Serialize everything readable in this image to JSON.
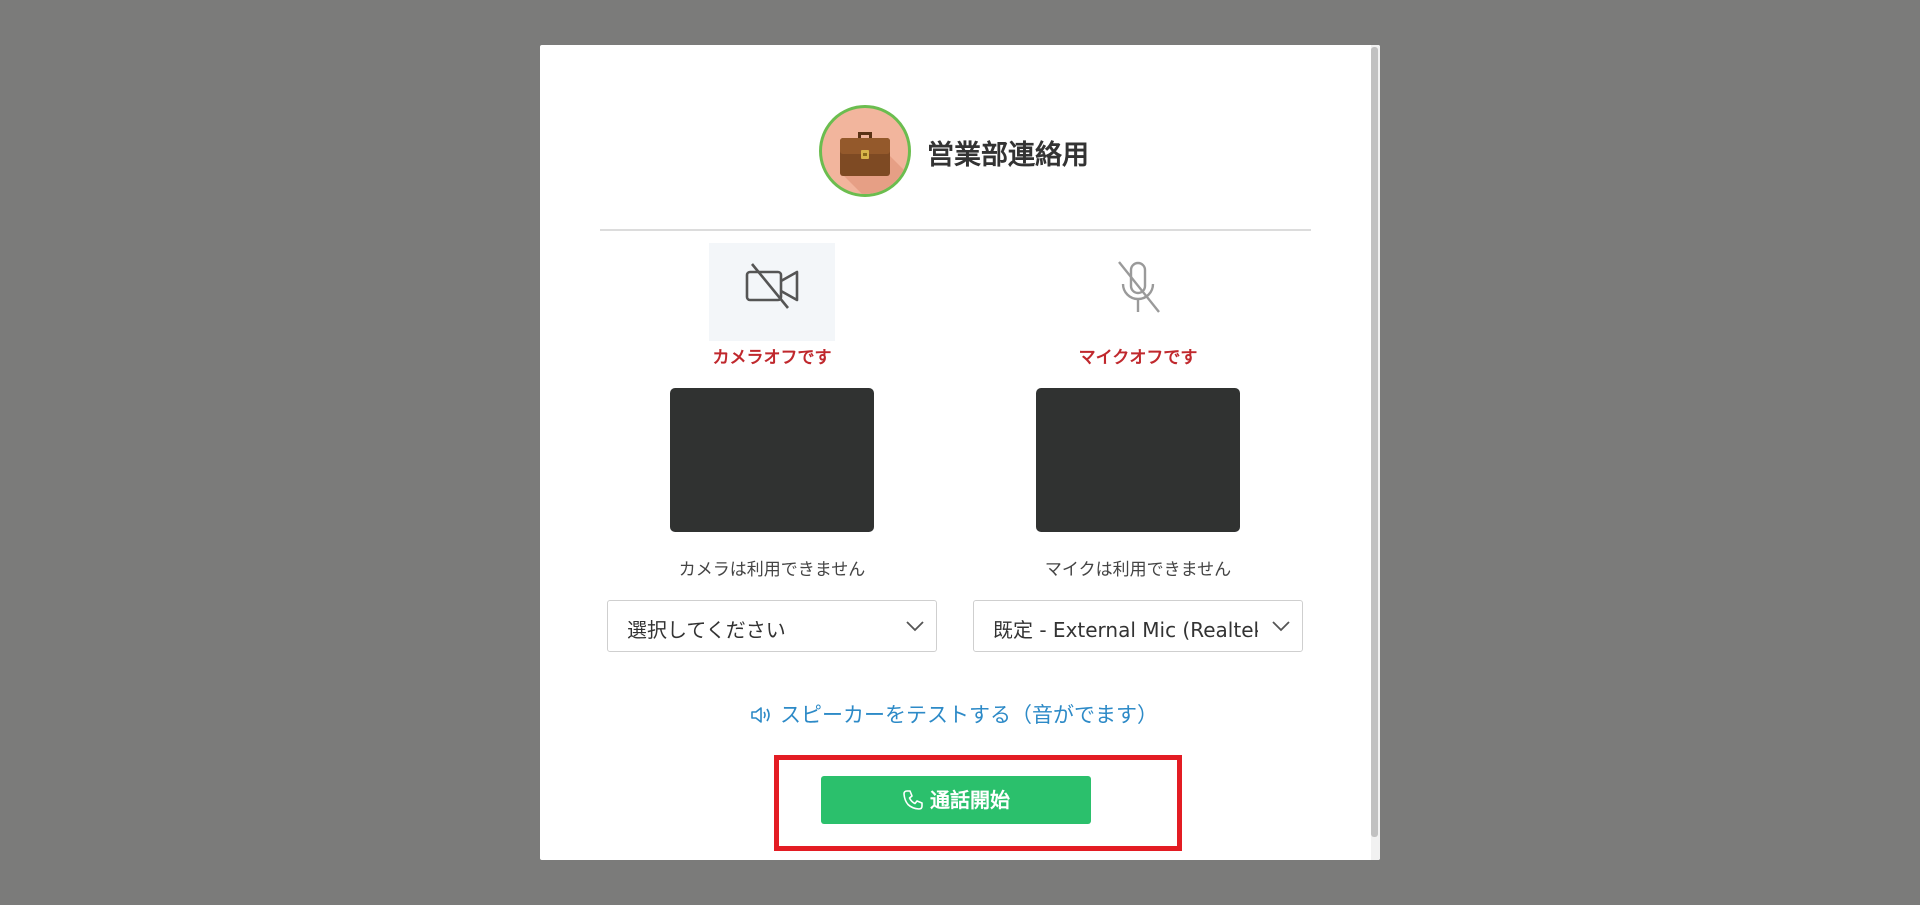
{
  "dialog": {
    "group_name": "営業部連絡用"
  },
  "camera": {
    "status": "カメラオフです",
    "unavailable_text": "カメラは利用できません",
    "select_value": "選択してください"
  },
  "mic": {
    "status": "マイクオフです",
    "unavailable_text": "マイクは利用できません",
    "select_value": "既定 - External Mic (Realtek("
  },
  "speaker_test": {
    "label": "スピーカーをテストする（音がでます）"
  },
  "call_button": {
    "label": "通話開始"
  },
  "icons": {
    "avatar": "briefcase-icon",
    "camera": "camera-off-icon",
    "mic": "mic-off-icon",
    "select": "chevron-down-icon",
    "speaker": "speaker-icon",
    "call": "phone-icon"
  },
  "colors": {
    "status_off": "#c0282d",
    "link": "#2d8ac7",
    "call_button": "#2bc06c",
    "highlight_box": "#e31c23",
    "avatar_border": "#6bbd4f"
  }
}
